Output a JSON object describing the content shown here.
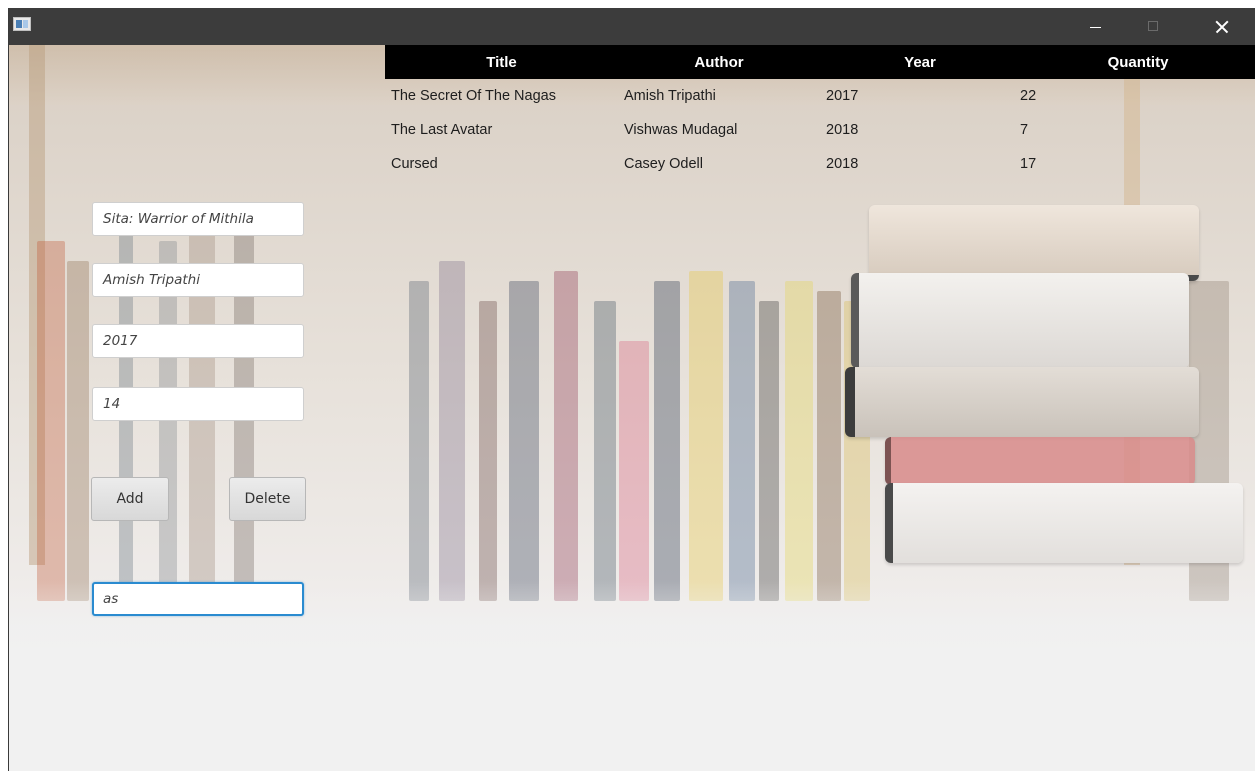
{
  "window": {
    "icon": "app-window-icon",
    "controls": [
      "minimize-icon",
      "maximize-icon",
      "close-icon"
    ]
  },
  "table": {
    "headers": [
      "Title",
      "Author",
      "Year",
      "Quantity"
    ],
    "rows": [
      [
        "The Secret Of The Nagas",
        "Amish Tripathi",
        "2017",
        "22"
      ],
      [
        "The Last Avatar",
        "Vishwas Mudagal",
        "2018",
        "7"
      ],
      [
        "Cursed",
        "Casey Odell",
        "2018",
        "17"
      ]
    ]
  },
  "form": {
    "title_value": "Sita: Warrior of Mithila",
    "author_value": "Amish Tripathi",
    "year_value": "2017",
    "quantity_value": "14",
    "add_label": "Add",
    "delete_label": "Delete",
    "search_value": "as"
  },
  "colors": {
    "header_bg": "#000000",
    "focus_border": "#2a8bd0",
    "titlebar": "#3c3c3c"
  }
}
